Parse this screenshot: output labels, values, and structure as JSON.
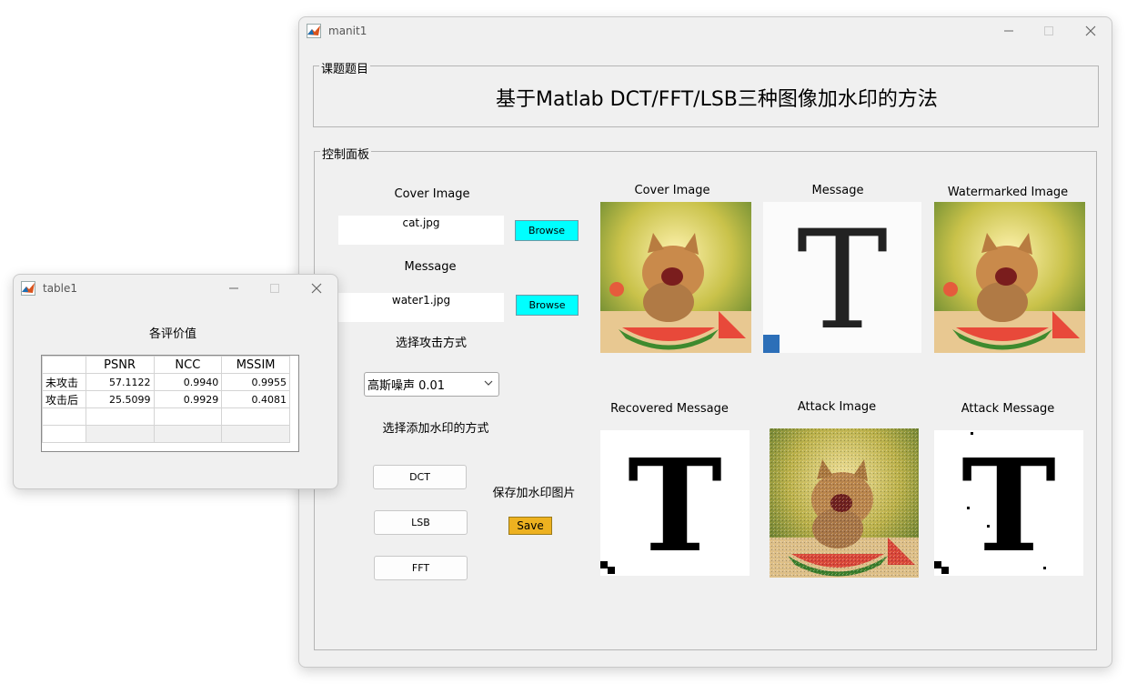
{
  "main_window": {
    "title": "manit1",
    "topic_panel": {
      "legend": "课题题目",
      "heading": "基于Matlab DCT/FFT/LSB三种图像加水印的方法"
    },
    "control_panel": {
      "legend": "控制面板",
      "cover_label": "Cover Image",
      "cover_value": "cat.jpg",
      "browse1": "Browse",
      "message_label": "Message",
      "message_value": "water1.jpg",
      "browse2": "Browse",
      "attack_label": "选择攻击方式",
      "attack_selected": "高斯噪声 0.01",
      "method_label": "选择添加水印的方式",
      "dct": "DCT",
      "lsb": "LSB",
      "fft": "FFT",
      "save_label": "保存加水印图片",
      "save": "Save",
      "img_titles": {
        "cover": "Cover Image",
        "message": "Message",
        "watermarked": "Watermarked Image",
        "recovered": "Recovered Message",
        "attack_image": "Attack Image",
        "attack_message": "Attack Message"
      },
      "watermark_letter": "T"
    }
  },
  "table_window": {
    "title": "table1",
    "heading": "各评价值",
    "columns": [
      "PSNR",
      "NCC",
      "MSSIM"
    ],
    "rows": [
      {
        "label": "未攻击",
        "values": [
          "57.1122",
          "0.9940",
          "0.9955"
        ]
      },
      {
        "label": "攻击后",
        "values": [
          "25.5099",
          "0.9929",
          "0.4081"
        ]
      }
    ]
  },
  "colors": {
    "window_bg": "#f0f0f0",
    "browse_button": "#00ffff",
    "save_button": "#edb120"
  },
  "icons": {
    "app": "matlab-icon",
    "minimize": "minimize-icon",
    "maximize": "maximize-icon",
    "close": "close-icon",
    "dropdown": "chevron-down-icon"
  }
}
